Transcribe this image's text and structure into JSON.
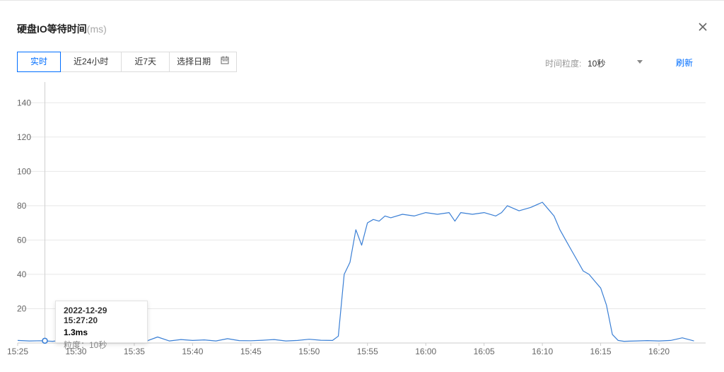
{
  "dialog": {
    "title": "硬盘IO等待时间",
    "title_unit": "(ms)",
    "close_icon": "close-icon"
  },
  "toolbar": {
    "ranges": [
      {
        "label": "实时",
        "active": true
      },
      {
        "label": "近24小时",
        "active": false
      },
      {
        "label": "近7天",
        "active": false
      }
    ],
    "date_picker_label": "选择日期",
    "date_picker_icon": "calendar-icon",
    "granularity_label": "时间粒度:",
    "granularity_value": "10秒",
    "refresh_label": "刷新"
  },
  "tooltip": {
    "time": "2022-12-29 15:27:20",
    "value": "1.3ms",
    "granularity": "粒度：10秒"
  },
  "colors": {
    "accent": "#006eff",
    "line": "#3a7fd5",
    "grid": "#e8e8e8"
  },
  "chart_data": {
    "type": "line",
    "title": "",
    "xlabel": "",
    "ylabel": "",
    "ylim": [
      0,
      150
    ],
    "xlim": [
      "15:25",
      "16:24"
    ],
    "y_ticks": [
      20,
      40,
      60,
      80,
      100,
      120,
      140
    ],
    "x_ticks": [
      "15:25",
      "15:30",
      "15:35",
      "15:40",
      "15:45",
      "15:50",
      "15:55",
      "16:00",
      "16:05",
      "16:10",
      "16:15",
      "16:20"
    ],
    "grid": true,
    "legend": "none",
    "series": [
      {
        "x": [
          "15:25",
          "15:26",
          "15:27",
          "15:28",
          "15:29",
          "15:30",
          "15:31",
          "15:32",
          "15:33",
          "15:34",
          "15:35",
          "15:36",
          "15:37",
          "15:38",
          "15:39",
          "15:40",
          "15:41",
          "15:42",
          "15:43",
          "15:44",
          "15:45",
          "15:46",
          "15:47",
          "15:48",
          "15:49",
          "15:50",
          "15:51",
          "15:52",
          "15:52:30",
          "15:53",
          "15:53:30",
          "15:54",
          "15:54:30",
          "15:55",
          "15:55:30",
          "15:56",
          "15:56:30",
          "15:57",
          "15:58",
          "15:59",
          "16:00",
          "16:01",
          "16:02",
          "16:02:30",
          "16:03",
          "16:04",
          "16:05",
          "16:06",
          "16:06:30",
          "16:07",
          "16:08",
          "16:09",
          "16:10",
          "16:10:30",
          "16:11",
          "16:11:30",
          "16:12",
          "16:12:30",
          "16:13",
          "16:13:30",
          "16:14",
          "16:14:30",
          "16:15",
          "16:15:30",
          "16:16",
          "16:16:30",
          "16:17",
          "16:18",
          "16:19",
          "16:20",
          "16:21",
          "16:22",
          "16:23"
        ],
        "y": [
          1.5,
          1.2,
          1.3,
          1.0,
          1.8,
          1.4,
          1.1,
          2.0,
          1.6,
          1.2,
          1.5,
          1.0,
          3.5,
          1.2,
          2.0,
          1.5,
          1.8,
          1.2,
          2.5,
          1.4,
          1.3,
          1.6,
          2.0,
          1.2,
          1.5,
          2.2,
          1.6,
          1.5,
          4,
          40,
          47,
          66,
          57,
          70,
          72,
          71,
          74,
          73,
          75,
          74,
          76,
          75,
          76,
          71,
          76,
          75,
          76,
          74,
          76,
          80,
          77,
          79,
          82,
          78,
          74,
          66,
          60,
          54,
          48,
          42,
          40,
          36,
          32,
          22,
          5,
          1.5,
          1.0,
          1.2,
          1.4,
          1.2,
          1.5,
          3.0,
          1.2
        ]
      }
    ],
    "highlight_point": {
      "x": "15:27:20",
      "y": 1.3
    }
  }
}
